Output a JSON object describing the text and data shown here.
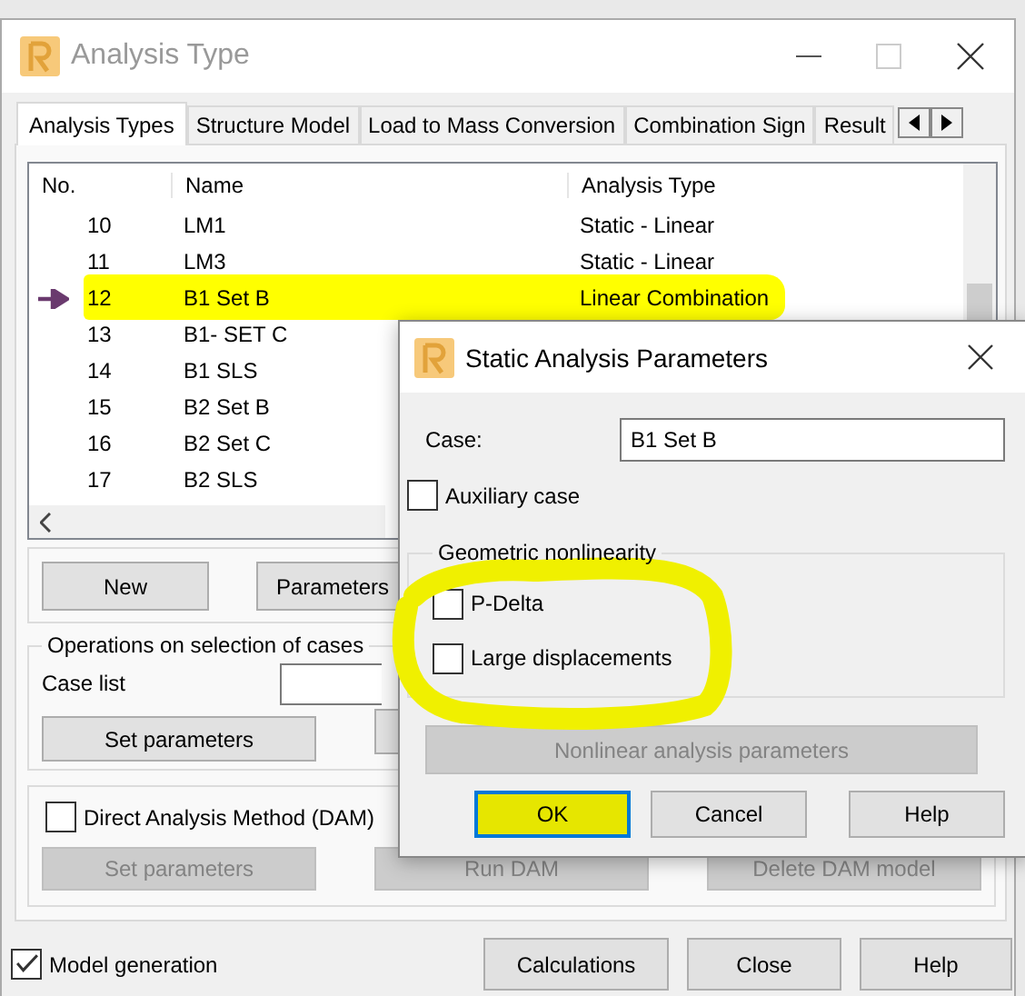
{
  "window": {
    "title": "Analysis Type"
  },
  "tabs": [
    {
      "label": "Analysis Types",
      "selected": true
    },
    {
      "label": "Structure Model",
      "selected": false
    },
    {
      "label": "Load to Mass Conversion",
      "selected": false
    },
    {
      "label": "Combination Sign",
      "selected": false
    },
    {
      "label": "Result",
      "selected": false
    }
  ],
  "case_list": {
    "columns": [
      "No.",
      "Name",
      "Analysis Type"
    ],
    "rows": [
      {
        "no": "10",
        "name": "LM1",
        "analysis_type": "Static - Linear",
        "current": false,
        "highlighted": false
      },
      {
        "no": "11",
        "name": "LM3",
        "analysis_type": "Static - Linear",
        "current": false,
        "highlighted": false
      },
      {
        "no": "12",
        "name": "B1 Set B",
        "analysis_type": "Linear Combination",
        "current": true,
        "highlighted": true
      },
      {
        "no": "13",
        "name": "B1- SET C",
        "current": false,
        "highlighted": false
      },
      {
        "no": "14",
        "name": "B1 SLS",
        "current": false,
        "highlighted": false
      },
      {
        "no": "15",
        "name": "B2 Set B",
        "current": false,
        "highlighted": false
      },
      {
        "no": "16",
        "name": "B2 Set C",
        "current": false,
        "highlighted": false
      },
      {
        "no": "17",
        "name": "B2 SLS",
        "current": false,
        "highlighted": false
      }
    ]
  },
  "list_buttons": [
    "New",
    "Parameters"
  ],
  "operations": {
    "title": "Operations on selection of cases",
    "case_list_label": "Case list",
    "buttons": [
      "Set parameters"
    ]
  },
  "dam": {
    "label": "Direct Analysis Method (DAM)",
    "checked": false,
    "buttons": [
      {
        "label": "Set parameters",
        "disabled": true
      },
      {
        "label": "Run DAM",
        "disabled": true
      },
      {
        "label": "Delete DAM model",
        "disabled": true
      }
    ]
  },
  "model_generation": {
    "label": "Model generation",
    "checked": true
  },
  "footer_buttons": [
    "Calculations",
    "Close",
    "Help"
  ],
  "dialog": {
    "title": "Static Analysis Parameters",
    "case_label": "Case:",
    "case_value": "B1 Set B",
    "auxiliary": {
      "label": "Auxiliary case",
      "checked": false
    },
    "geometric": {
      "title": "Geometric nonlinearity",
      "highlighted": true,
      "options": [
        {
          "label": "P-Delta",
          "checked": false
        },
        {
          "label": "Large displacements",
          "checked": false
        }
      ]
    },
    "nonlinear_button": {
      "label": "Nonlinear analysis parameters",
      "disabled": true
    },
    "buttons": [
      {
        "label": "OK",
        "focused": true,
        "highlighted": true
      },
      {
        "label": "Cancel",
        "focused": false,
        "highlighted": false
      },
      {
        "label": "Help",
        "focused": false,
        "highlighted": false
      }
    ]
  }
}
